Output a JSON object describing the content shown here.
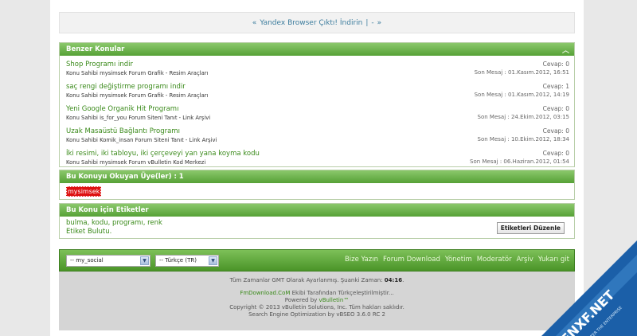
{
  "nav": {
    "left": "«",
    "link": "Yandex Browser Çıktı! İndirin",
    "sep": "|",
    "dash": "-",
    "right": "»"
  },
  "similar": {
    "title": "Benzer Konular",
    "threads": [
      {
        "title": "Shop Programı indir",
        "meta": "Konu Sahibi mysimsek Forum Grafik - Resim Araçları",
        "replies": "Cevap: 0",
        "last": "Son Mesaj : 01.Kasım.2012, 16:51"
      },
      {
        "title": "saç rengi değiştirme programı indir",
        "meta": "Konu Sahibi mysimsek Forum Grafik - Resim Araçları",
        "replies": "Cevap: 1",
        "last": "Son Mesaj : 01.Kasım.2012, 14:19"
      },
      {
        "title": "Yeni Google Organik Hit Programı",
        "meta": "Konu Sahibi is_for_you Forum Siteni Tanıt - Link Arşivi",
        "replies": "Cevap: 0",
        "last": "Son Mesaj : 24.Ekim.2012, 03:15"
      },
      {
        "title": "Uzak Masaüstü Bağlantı Programı",
        "meta": "Konu Sahibi Komik_insan Forum Siteni Tanıt - Link Arşivi",
        "replies": "Cevap: 0",
        "last": "Son Mesaj : 10.Ekim.2012, 18:34"
      },
      {
        "title": "İki resimi, iki tabloyu, iki çerçeveyi yan yana koyma kodu",
        "meta": "Konu Sahibi mysimsek Forum vBulletin Kod Merkezi",
        "replies": "Cevap: 0",
        "last": "Son Mesaj : 06.Haziran.2012, 01:54"
      }
    ]
  },
  "readers": {
    "title": "Bu Konuyu Okuyan Üye(ler) : 1",
    "user": "mysimsek"
  },
  "tags": {
    "title": "Bu Konu için Etiketler",
    "list": "bulma, kodu, programı, renk",
    "cloud": "Etiket Bulutu.",
    "edit_label": "Etiketleri Düzenle"
  },
  "footer": {
    "style_select": "-- my_social",
    "lang_select": "-- Türkçe (TR)",
    "links": [
      "Bize Yazın",
      "Forum Download",
      "Yönetim",
      "Moderatör",
      "Arşiv",
      "Yukarı git"
    ]
  },
  "copyright": {
    "time_prefix": "Tüm Zamanlar GMT Olarak Ayarlanmış. Şuanki Zaman:",
    "time": "04:16",
    "time_suffix": ".",
    "credit_site": "FmDownload.CoM",
    "credit_text": "Ekibi Tarafından Türkçeleştirilmiştir...",
    "powered_prefix": "Powered by",
    "powered_name": "vBulletin™",
    "copy_line": "Copyright © 2013 vBulletin Solutions, Inc. Tüm hakları saklıdır.",
    "seo_line": "Search Engine Optimization by vBSEO 3.6.0 RC 2"
  },
  "watermark": {
    "brand": "ENXF.NET",
    "sub": "ENTER THE ENTERPRISE",
    "colors": {
      "body": "#1b5fa8",
      "light": "#5aa6e6"
    }
  },
  "colors": {
    "accent_green": "#56a136",
    "link_green": "#3a8a1a",
    "reader_red": "#dd1111"
  }
}
